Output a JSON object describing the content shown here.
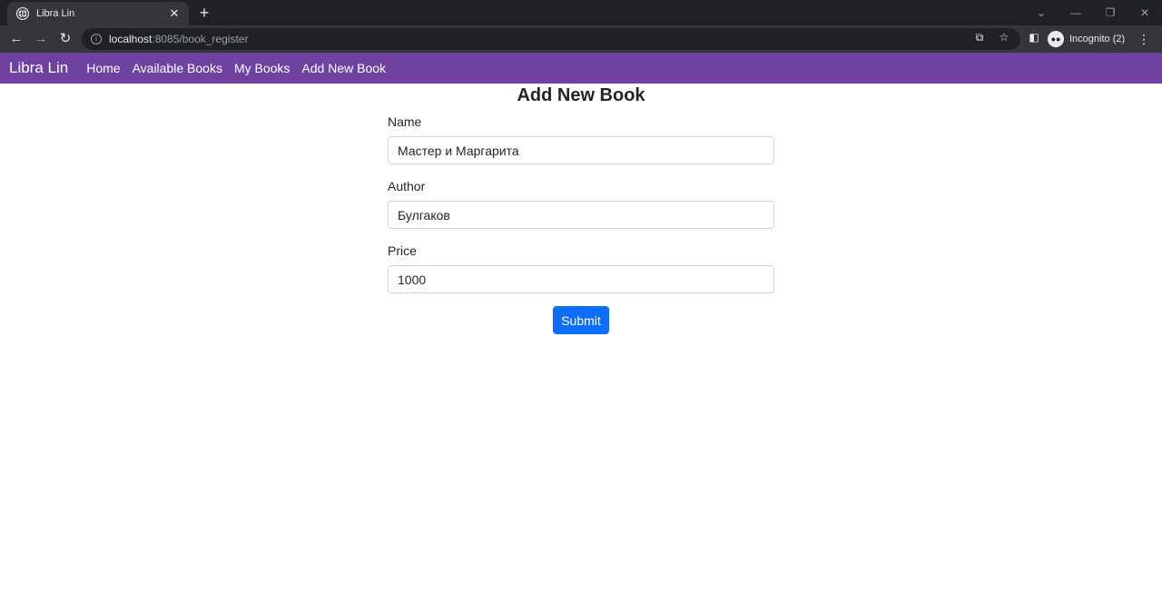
{
  "browser": {
    "tab_title": "Libra Lin",
    "tab_close": "✕",
    "new_tab": "+",
    "url_host": "localhost",
    "url_rest": ":8085/book_register",
    "profile_label": "Incognito (2)",
    "icons": {
      "back": "back-arrow-icon",
      "forward": "forward-arrow-icon",
      "reload": "reload-icon",
      "info": "site-info-icon",
      "translate": "translate-icon",
      "bookmark": "star-icon",
      "sidepanel": "side-panel-icon",
      "incognito": "incognito-icon",
      "menu": "kebab-menu-icon"
    }
  },
  "navbar": {
    "brand": "Libra Lin",
    "links": [
      "Home",
      "Available Books",
      "My Books",
      "Add New Book"
    ],
    "background": "#6f42a1"
  },
  "form": {
    "title": "Add New Book",
    "fields": [
      {
        "label": "Name",
        "value": "Мастер и Маргарита"
      },
      {
        "label": "Author",
        "value": "Булгаков"
      },
      {
        "label": "Price",
        "value": "1000"
      }
    ],
    "submit_label": "Submit",
    "submit_color": "#0d6efd"
  }
}
